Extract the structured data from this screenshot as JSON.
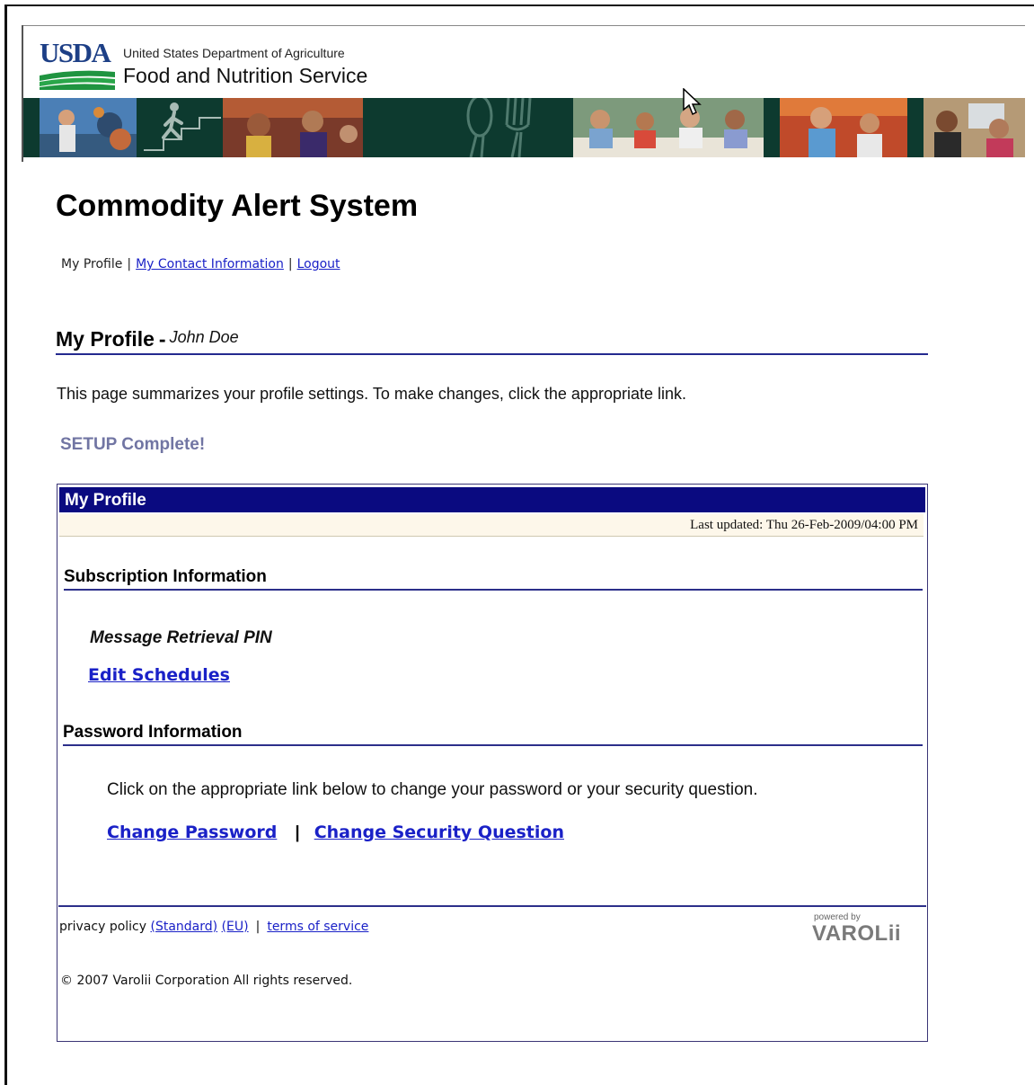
{
  "header": {
    "logo_text": "USDA",
    "agency_line1": "United States Department of Agriculture",
    "agency_line2": "Food and Nutrition Service",
    "banner_icons": [
      "person-climbing-stairs-icon",
      "spoon-fork-icon"
    ]
  },
  "page": {
    "title": "Commodity Alert System",
    "nav": {
      "current": "My Profile",
      "separator": "|",
      "contact_link": "My Contact Information",
      "logout_link": "Logout"
    },
    "profile_heading": "My Profile",
    "profile_dash": "-",
    "user_name": "John Doe",
    "summary": "This page summarizes your profile settings. To make changes, click the appropriate link.",
    "setup_status": "SETUP Complete!"
  },
  "profile_box": {
    "title": "My Profile",
    "last_updated": "Last updated: Thu 26-Feb-2009/04:00 PM",
    "subscription": {
      "heading": "Subscription Information",
      "pin_label": "Message Retrieval PIN",
      "edit_link": "Edit Schedules"
    },
    "password": {
      "heading": "Password Information",
      "description": "Click on the appropriate link below to change your password or your security question.",
      "change_password": "Change Password",
      "separator": "|",
      "change_security": "Change Security Question"
    }
  },
  "footer": {
    "privacy_label": "privacy policy",
    "standard_link": "(Standard)",
    "eu_link": "(EU)",
    "separator": "|",
    "terms_link": "terms of service",
    "powered_by": "powered by",
    "brand": "VAROLii",
    "copyright": "© 2007 Varolii Corporation All rights reserved."
  },
  "colors": {
    "link": "#1a21c7",
    "title_bar": "#0a0a80",
    "status": "#7175a3",
    "banner": "#0d3a2f"
  }
}
